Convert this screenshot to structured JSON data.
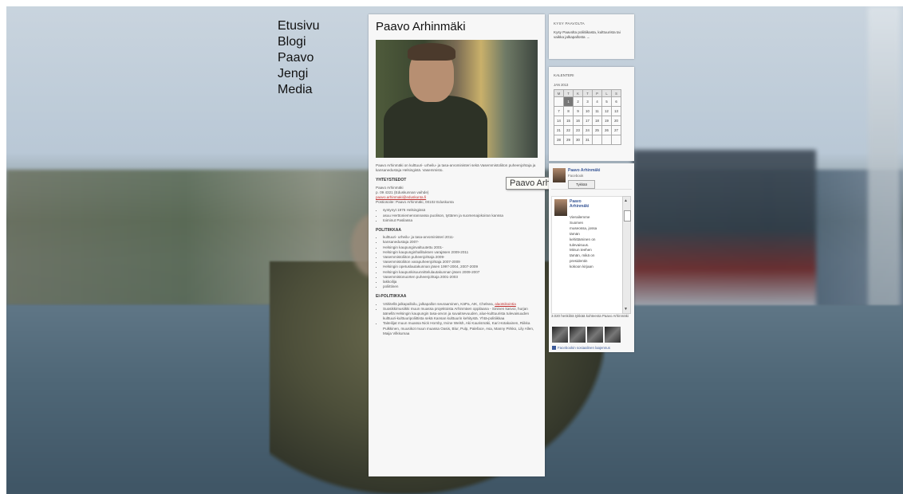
{
  "nav": [
    "Etusivu",
    "Blogi",
    "Paavo",
    "Jengi",
    "Media"
  ],
  "main": {
    "title": "Paavo Arhinmäki",
    "intro": "Paavo Arhinmäki on kulttuuri- urheilu- ja tasa-arvoministeri sekä Vasemmistoliiton puheenjohtaja ja kansanedustaja Helsingistä. Vasemmisto.",
    "contact_heading": "YHTEYSTIEDOT",
    "contact_name": "Paavo Arhinmäki",
    "contact_phone": "p. 09 4321 (Eduskunnan vaihde)",
    "contact_email": "paavo.arhinmaki@eduskunta.fi",
    "contact_address": "Postiosoite: Paavo Arhinmäki, 00102 Eduskunta",
    "bio": [
      "syntynyt 1976 Helsingissä",
      "asuu Herttoniemenrannassa puolison, tyttären ja suomenajokoiran kanssa",
      "toiminut Pasilassa"
    ],
    "politics_heading": "POLITIIKKAA",
    "politics": [
      "kulttuuri- urheilu- ja tasa-arvoministeri 2011-",
      "kansanedustaja 2007-",
      "Helsingin kaupunginvaltuutettu 2001-",
      "Helsingin kaupunginhallituksen varajäsen 2009-2011",
      "Vasemmistoliiton puheenjohtaja 2009-",
      "Vasemmistoliiton varapuheenjohtaja 2007-2009",
      "Helsingin opetuslautakunnan jäsen 1997-2004, 2007-2009",
      "Helsingin kaupunkisuunnittelulautakunnan jäsen 2009-2007",
      "Vasemmistonuorten puheenjohtaja 2001-2003",
      "lakkoilija",
      "poliittinen"
    ],
    "nonpol_heading": "EI-POLITIIKKAA",
    "nonpol": [
      "Vähitellä jalkapalloilu, jalkapallon seuraaminen, KäPa, AIK, Chelsea,",
      "Suosikkimusiikki muun muassa projektoista Arhinmäen oppilaana - Sininen kasvoi, hurjan äänellä Helsingin kaupungin tasa-arvon ja suvaitsevuuden, alue-kulttuurista tulevaisuuden kulttuuri-kulttuuripoliittista sekä Kansan kulttuurin kehitystä. Yhtä-politiikkaa",
      "Taiteilijat muun muassa Nick Hornby, Irvine Welsh, Aki Kaurismäki, Kari Hotakainen, Riikka Pulkkinen, muusikot muun muassa Oasis, Blur, Pulp, Paleface, Asa, Manny Pirkko, Lily Allen, Maija Vilkkumaa"
    ],
    "link_text": "alaotsikointia"
  },
  "tooltip": "Paavo Arhinmäki",
  "sidebar": {
    "ask": {
      "title": "KYSY PAAVOLTA",
      "body": "Kysy Paavolta poliitiikasta, kulttuurista tai vaikka jalkapallosta →"
    },
    "calendar": {
      "title": "KALENTERI",
      "month": "JAN 2013",
      "weekdays": [
        "M",
        "T",
        "K",
        "T",
        "P",
        "L",
        "S"
      ],
      "weeks": [
        [
          "",
          "1",
          "2",
          "3",
          "4",
          "5",
          "6"
        ],
        [
          "7",
          "8",
          "9",
          "10",
          "11",
          "12",
          "13"
        ],
        [
          "14",
          "15",
          "16",
          "17",
          "18",
          "19",
          "20"
        ],
        [
          "21",
          "22",
          "23",
          "24",
          "25",
          "26",
          "27"
        ],
        [
          "28",
          "29",
          "30",
          "31",
          "",
          "",
          ""
        ]
      ],
      "today": "1"
    },
    "facebook": {
      "name": "Paavo Arhinmäki",
      "sub": "Facebook",
      "like_label": "Tykkää",
      "post_name": "Paavo Arhinmäki",
      "post_text": "Vierailemme Suomen museossa, jossa tämän kehittäminen on tulevaisuus. Minun teehen tämän, mikä on presidentin kokoon kirjaan",
      "likes_text": "3.020 henkilöä tykkää kohteesta Paavo Arhinmäki",
      "footer": "Facebookin sosiaalinen laajennus"
    }
  }
}
